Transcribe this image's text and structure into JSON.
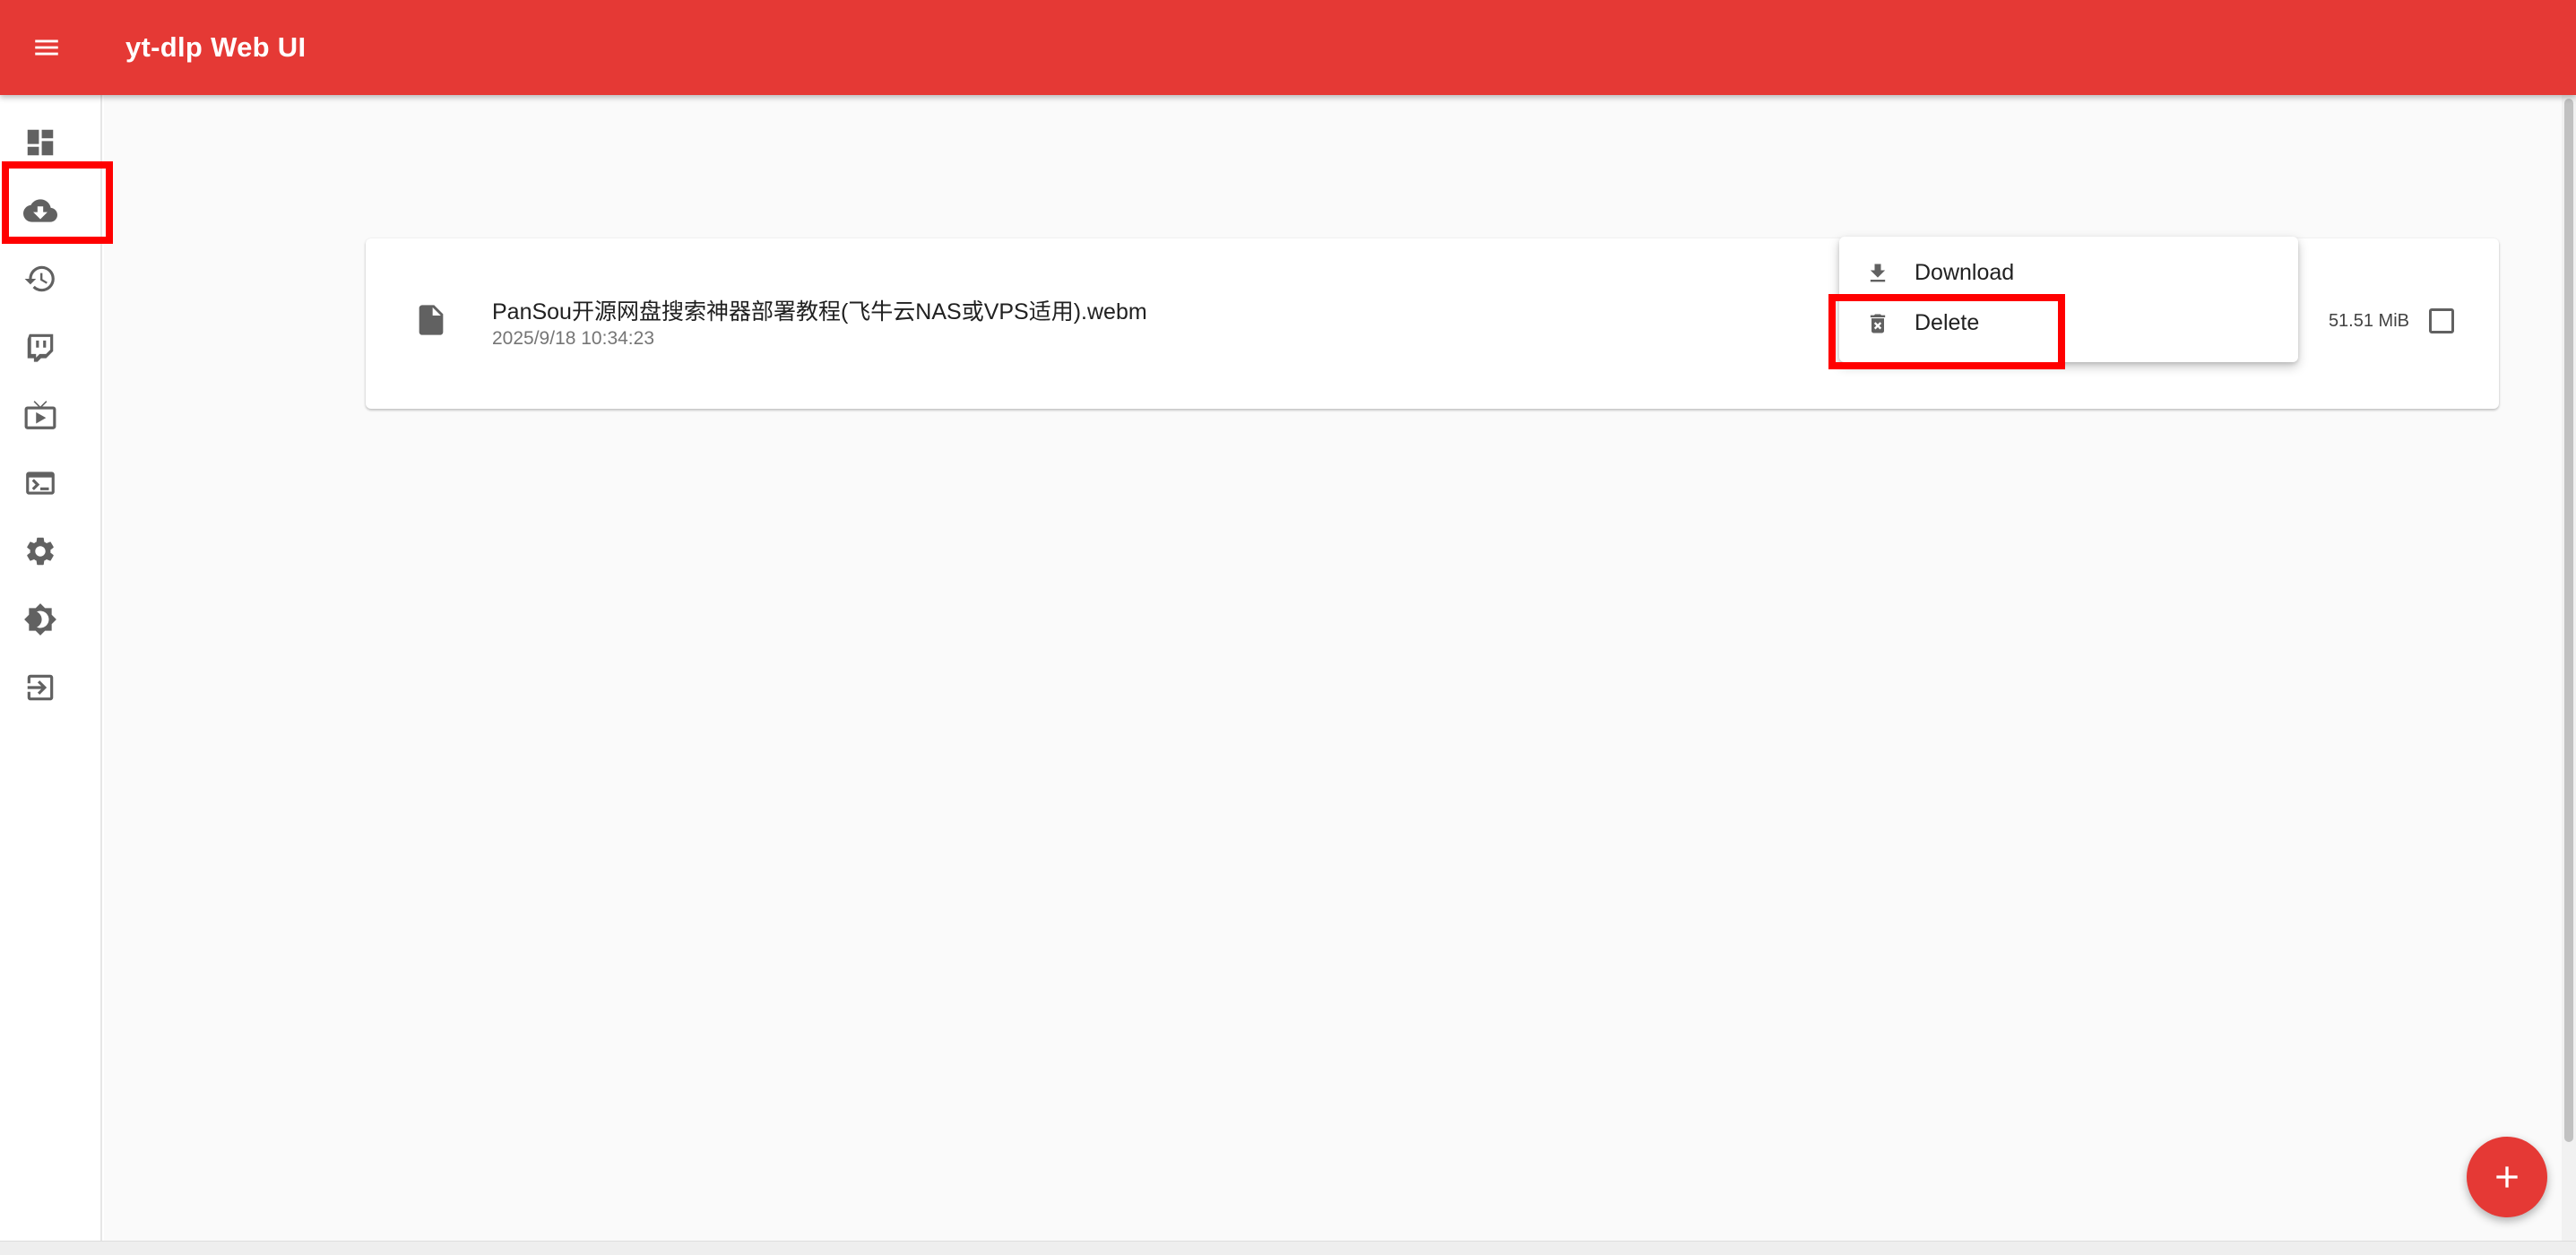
{
  "app": {
    "title": "yt-dlp Web UI",
    "accent_color": "#e53935",
    "highlight_color": "#ff0000"
  },
  "sidebar": {
    "items": [
      {
        "icon": "dashboard-icon"
      },
      {
        "icon": "cloud-download-icon"
      },
      {
        "icon": "history-icon"
      },
      {
        "icon": "twitch-icon"
      },
      {
        "icon": "live-tv-icon"
      },
      {
        "icon": "terminal-icon"
      },
      {
        "icon": "settings-gear-icon"
      },
      {
        "icon": "brightness-theme-icon"
      },
      {
        "icon": "logout-icon"
      }
    ]
  },
  "files": [
    {
      "name": "PanSou开源网盘搜索神器部署教程(飞牛云NAS或VPS适用).webm",
      "date": "2025/9/18 10:34:23",
      "size": "51.51 MiB",
      "icon": "video-file-icon"
    }
  ],
  "context_menu": {
    "items": [
      {
        "label": "Download",
        "icon": "download-icon"
      },
      {
        "label": "Delete",
        "icon": "delete-icon"
      }
    ]
  },
  "fab": {
    "icon": "plus-icon"
  }
}
